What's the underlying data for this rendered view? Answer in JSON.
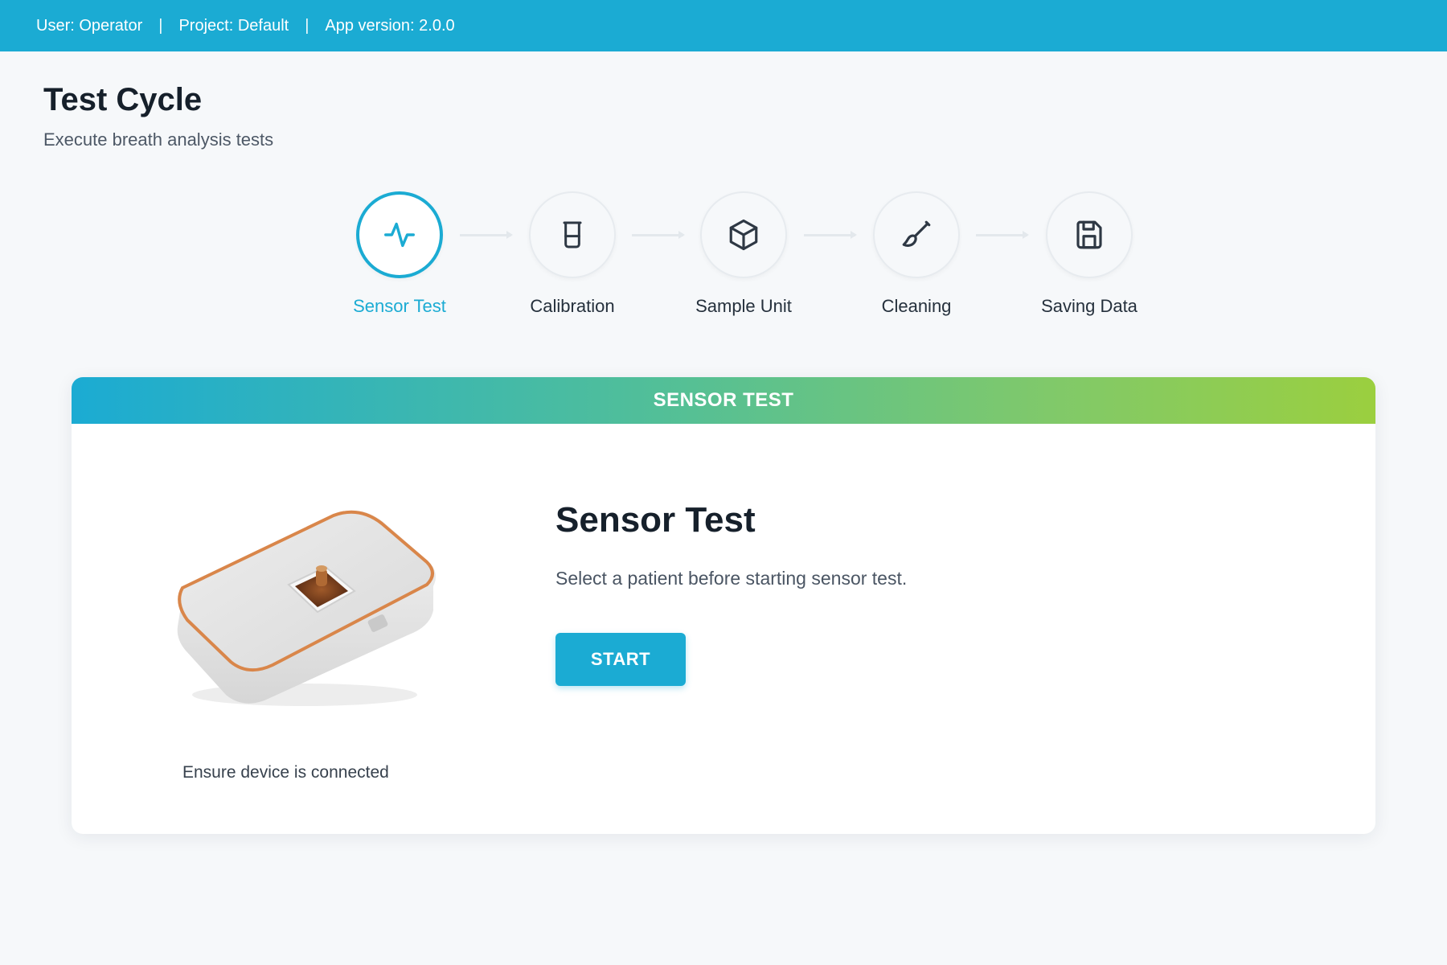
{
  "topbar": {
    "user": "User: Operator",
    "project": "Project: Default",
    "version": "App version: 2.0.0",
    "separator": "|",
    "color": "#1babd3"
  },
  "page": {
    "title": "Test Cycle",
    "subtitle": "Execute breath analysis tests"
  },
  "steps": [
    {
      "label": "Sensor Test",
      "icon": "activity-icon",
      "active": true
    },
    {
      "label": "Calibration",
      "icon": "beaker-icon",
      "active": false
    },
    {
      "label": "Sample Unit",
      "icon": "cube-icon",
      "active": false
    },
    {
      "label": "Cleaning",
      "icon": "brush-icon",
      "active": false
    },
    {
      "label": "Saving Data",
      "icon": "save-icon",
      "active": false
    }
  ],
  "panel": {
    "header": "SENSOR TEST",
    "title": "Sensor Test",
    "message": "Select a patient before starting sensor test.",
    "start_label": "START",
    "device_caption": "Ensure device is connected"
  },
  "colors": {
    "accent": "#1babd3",
    "gradient_end": "#9bcf3f"
  }
}
